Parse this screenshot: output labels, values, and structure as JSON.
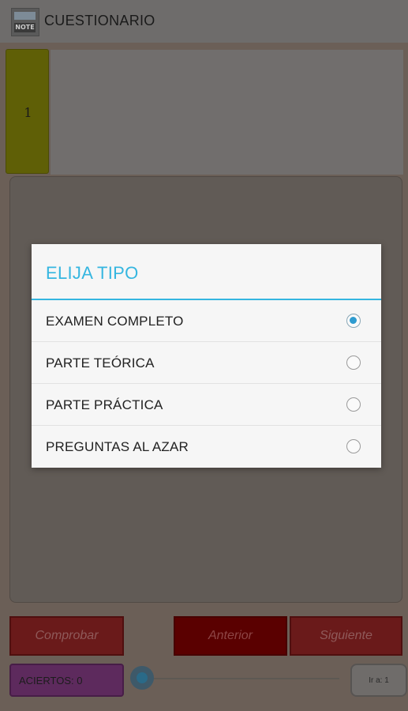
{
  "app": {
    "title": "CUESTIONARIO",
    "logo_text": "NOTE"
  },
  "question_strip": {
    "current_number": "1"
  },
  "buttons": {
    "check": "Comprobar",
    "previous": "Anterior",
    "next": "Siguiente",
    "go_to": "Ir a: 1"
  },
  "score": {
    "label": "ACIERTOS: 0"
  },
  "slider": {
    "value": 0
  },
  "dialog": {
    "title": "ELIJA TIPO",
    "options": [
      {
        "label": "EXAMEN COMPLETO",
        "selected": true
      },
      {
        "label": "PARTE TEÓRICA",
        "selected": false
      },
      {
        "label": "PARTE PRÁCTICA",
        "selected": false
      },
      {
        "label": "PREGUNTAS AL AZAR",
        "selected": false
      }
    ]
  },
  "colors": {
    "accent": "#35b6e0",
    "radio_selected": "#2e9bd0"
  },
  "icons": {
    "logo": "app-logo-icon"
  }
}
